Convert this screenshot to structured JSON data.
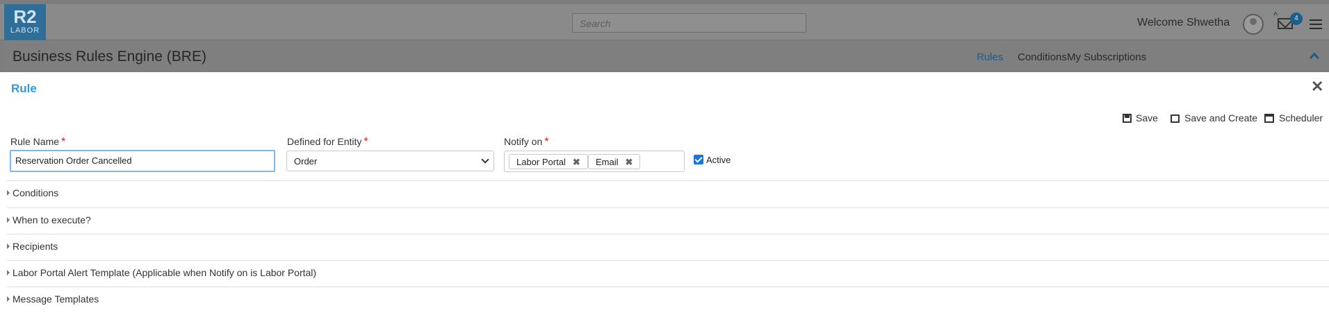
{
  "header": {
    "logo_main": "R2",
    "logo_sub": "LABOR",
    "search_placeholder": "Search",
    "welcome": "Welcome Shwetha",
    "mail_count": "4",
    "page_title": "Business Rules Engine (BRE)",
    "nav": [
      {
        "label": "Rules",
        "active": true
      },
      {
        "label": "Conditions",
        "active": false
      },
      {
        "label": "My Subscriptions",
        "active": false
      }
    ]
  },
  "modal": {
    "title": "Rule",
    "toolbar": {
      "save": "Save",
      "save_and_create": "Save and Create",
      "scheduler": "Scheduler"
    },
    "fields": {
      "rule_name_label": "Rule Name",
      "rule_name_value": "Reservation Order Cancelled",
      "entity_label": "Defined for Entity",
      "entity_value": "Order",
      "notify_label": "Notify on",
      "notify_tags": [
        "Labor Portal",
        "Email"
      ],
      "active_label": "Active",
      "active_checked": true,
      "required_mark": "*"
    },
    "sections": [
      "Conditions",
      "When to execute?",
      "Recipients",
      "Labor Portal Alert Template (Applicable when Notify on is Labor Portal)",
      "Message Templates"
    ]
  },
  "colors": {
    "accent": "#2e9be0",
    "required": "#e02020",
    "checkbox": "#1a73d9"
  }
}
